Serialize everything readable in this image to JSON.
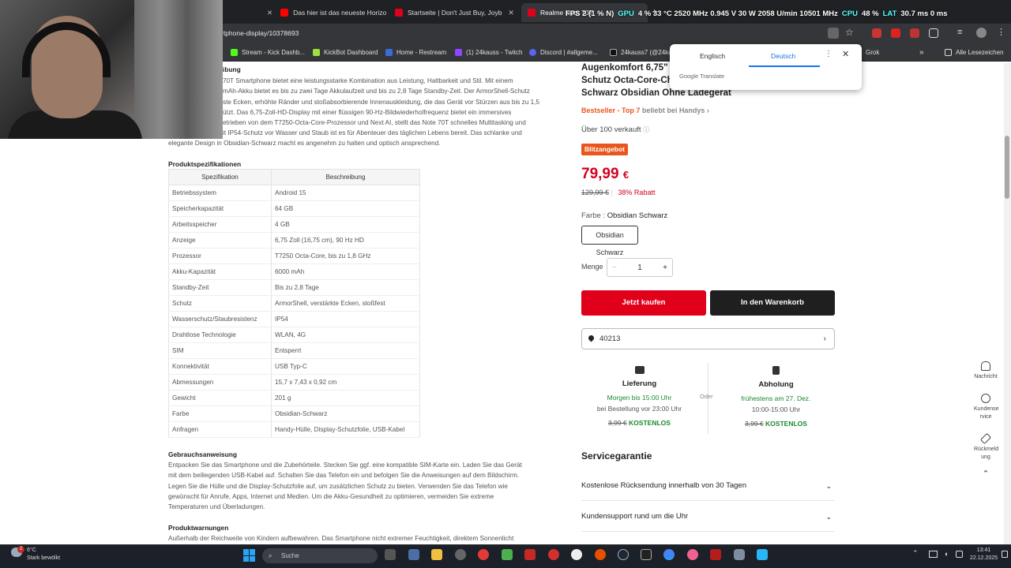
{
  "browser": {
    "tabs": [
      {
        "label": "Das hier ist das neueste Horizo",
        "color": "#ff0000"
      },
      {
        "label": "Startseite | Don't Just Buy, Joyb",
        "color": "#e1001a"
      },
      {
        "label": "Realme Note 70T",
        "color": "#e1001a"
      }
    ],
    "new_tab": "+",
    "url": "rtphone-display/10378693",
    "bookmarks": [
      "Stream - Kick Dashb...",
      "KickBot Dashboard",
      "Home - Restream",
      "(1) 24kauss - Twitch",
      "Discord | #allgeme...",
      "24kauss7 (@24ka",
      "Grok",
      "Alle Lesezeichen"
    ]
  },
  "overlay": {
    "fps": "FPS 2 (1 % N)",
    "gpu_label": "GPU",
    "gpu": "4 % 33 °C 2520 MHz 0.945 V 30 W 2058 U/min 10501 MHz",
    "cpu_label": "CPU",
    "cpu": "48 %",
    "lat_label": "LAT",
    "lat": "30.7 ms 0 ms"
  },
  "translate": {
    "lang1": "Englisch",
    "lang2": "Deutsch",
    "logo": "Google Translate"
  },
  "left": {
    "section_partial": "ibung",
    "description_lines": [
      "70T Smartphone bietet eine leistungsstarke Kombination aus Leistung, Haltbarkeit und Stil. Mit einem",
      "mAh-Akku bietet es bis zu zwei Tage Akkulaufzeit und bis zu 2,8 Tage Standby-Zeit. Der ArmorShell-Schutz",
      "ste Ecken, erhöhte Ränder und stoßabsorbierende Innenauskleidung, die das Gerät vor Stürzen aus bis zu 1,5",
      "ützt. Das 6,75-Zoll-HD-Display mit einer flüssigen 90-Hz-Bildwiederholfrequenz bietet ein immersives",
      "etrieben von dem T7250-Octa-Core-Prozessor und Next AI, stellt das Note 70T schnelles Multitasking und",
      "it IP54-Schutz vor Wasser und Staub ist es für Abenteuer des täglichen Lebens bereit. Das schlanke und",
      "elegante Design in Obsidian-Schwarz macht es angenehm zu halten und optisch ansprechend."
    ],
    "specs_heading": "Produktspezifikationen",
    "specs_headers": [
      "Spezifikation",
      "Beschreibung"
    ],
    "specs": [
      [
        "Betriebssystem",
        "Android 15"
      ],
      [
        "Speicherkapazität",
        "64 GB"
      ],
      [
        "Arbeitsspeicher",
        "4 GB"
      ],
      [
        "Anzeige",
        "6,75 Zoll (16,75 cm), 90 Hz HD"
      ],
      [
        "Prozessor",
        "T7250 Octa-Core, bis zu 1,8 GHz"
      ],
      [
        "Akku-Kapazität",
        "6000 mAh"
      ],
      [
        "Standby-Zeit",
        "Bis zu 2,8 Tage"
      ],
      [
        "Schutz",
        "ArmorShell, verstärkte Ecken, stoßfest"
      ],
      [
        "Wasserschutz/Staubresistenz",
        "IP54"
      ],
      [
        "Drahtlose Technologie",
        "WLAN, 4G"
      ],
      [
        "SIM",
        "Entsperrt"
      ],
      [
        "Konnektivität",
        "USB Typ-C"
      ],
      [
        "Abmessungen",
        "15,7 x 7,43 x 0,92 cm"
      ],
      [
        "Gewicht",
        "201 g"
      ],
      [
        "Farbe",
        "Obsidian-Schwarz"
      ],
      [
        "Anfragen",
        "Handy-Hülle, Display-Schutzfolie, USB-Kabel"
      ]
    ],
    "usage_heading": "Gebrauchsanweisung",
    "usage_lines": [
      "Entpacken Sie das Smartphone und die Zubehörteile. Stecken Sie ggf. eine kompatible SIM-Karte ein. Laden Sie das Gerät",
      "mit dem beiliegenden USB-Kabel auf. Schalten Sie das Telefon ein und befolgen Sie die Anweisungen auf dem Bildschirm.",
      "Legen Sie die Hülle und die Display-Schutzfolie auf, um zusätzlichen Schutz zu bieten. Verwenden Sie das Telefon wie",
      "gewünscht für Anrufe, Apps, Internet und Medien. Um die Akku-Gesundheit zu optimieren, vermeiden Sie extreme",
      "Temperaturen und Überladungen."
    ],
    "warnings_heading": "Produktwarnungen",
    "warnings_line": "Außerhalb der Reichweite von Kindern aufbewahren. Das Smartphone nicht extremer Feuchtigkeit, direktem Sonnenlicht"
  },
  "product": {
    "title_lines": [
      "Augenkomfort 6,75\"",
      "Schutz Octa-Core-Ch",
      "Schwarz Obsidian Ohne Ladegerät"
    ],
    "bestseller": "Bestseller - Top 7",
    "bestseller_suffix": "beliebt bei Handys",
    "sold": "Über 100 verkauft",
    "flash": "Blitzangebot",
    "price": "79,99",
    "currency": "€",
    "old_price": "129,99 €",
    "discount": "38% Rabatt",
    "color_label": "Farbe :",
    "color_value": "Obsidian Schwarz",
    "color_button": "Obsidian Schwarz",
    "qty_label": "Menge",
    "qty_minus": "−",
    "qty": "1",
    "qty_plus": "+",
    "buy_now": "Jetzt kaufen",
    "add_to_cart": "In den Warenkorb",
    "zip": "40213",
    "delivery_title": "Lieferung",
    "delivery_time": "Morgen bis 15:00 Uhr",
    "delivery_cond": "bei Bestellung vor 23:00 Uhr",
    "delivery_old": "3,99 €",
    "delivery_free": "KOSTENLOS",
    "or": "Oder",
    "pickup_title": "Abholung",
    "pickup_date": "frühestens am 27. Dez.",
    "pickup_time": "10:00-15:00 Uhr",
    "pickup_old": "3,99 €",
    "pickup_free": "KOSTENLOS",
    "service_title": "Servicegarantie",
    "service_items": [
      "Kostenlose Rücksendung innerhalb von 30 Tagen",
      "Kundensupport rund um die Uhr"
    ]
  },
  "floating": {
    "notifications": "Nachricht",
    "service": "Kundense rvice",
    "feedback": "Rückmeld ung"
  },
  "taskbar": {
    "temp": "6°C",
    "weather": "Stark bewölkt",
    "badge": "2",
    "search": "Suche",
    "time": "13:41",
    "date": "22.12.2025"
  }
}
